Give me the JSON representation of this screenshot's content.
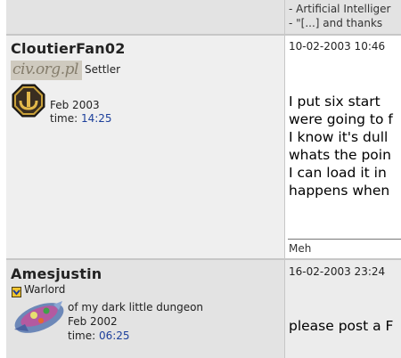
{
  "prev_post": {
    "signature_lines": [
      "- Artificial Intelliger",
      "- \"[...] and thanks"
    ]
  },
  "post1": {
    "username": "CloutierFan02",
    "rank": "Settler",
    "rank_image_text": "civ.org.pl",
    "joined": "Feb 2003",
    "time_label": "time:",
    "time_value": "14:25",
    "date": "10-02-2003 10:46",
    "message_lines": [
      "I put six start",
      "were going to f",
      "I know it's dull",
      "whats the poin",
      "I can load it in",
      "happens when"
    ],
    "signature": "Meh"
  },
  "post2": {
    "username": "Amesjustin",
    "rank": "Warlord",
    "location": "of my dark little dungeon",
    "joined": "Feb 2002",
    "time_label": "time:",
    "time_value": "06:25",
    "date": "16-02-2003 23:24",
    "message": "please post a F"
  }
}
